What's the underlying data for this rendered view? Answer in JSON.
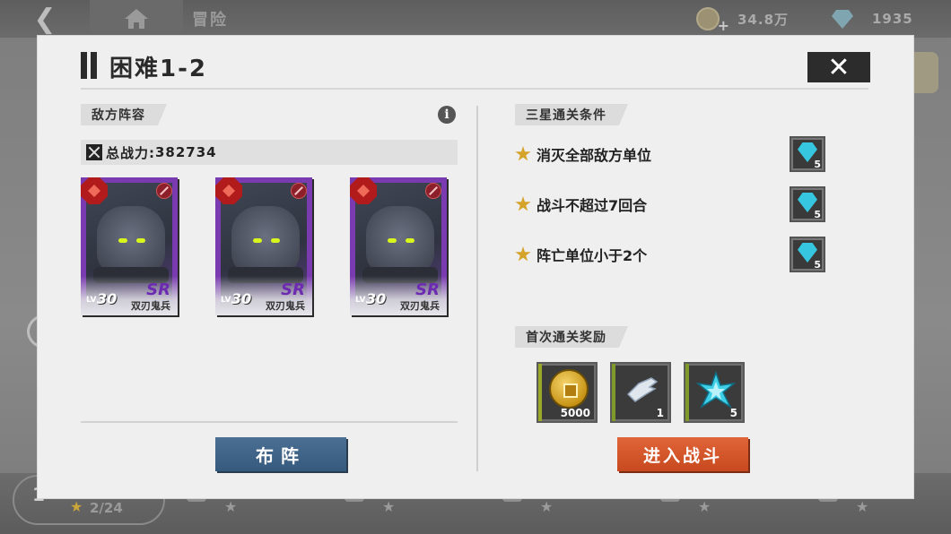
{
  "topbar": {
    "crumb": "冒险",
    "coins": "34.8万",
    "gems": "1935"
  },
  "bottom": {
    "chapter_num": "1",
    "progress": "2/24"
  },
  "dialog": {
    "title": "困难1-2",
    "enemy_section": "敌方阵容",
    "power_label": "总战力:",
    "power_value": "382734",
    "units": [
      {
        "level_label": "LV",
        "level": "30",
        "rarity": "SR",
        "name": "双刃鬼兵"
      },
      {
        "level_label": "LV",
        "level": "30",
        "rarity": "SR",
        "name": "双刃鬼兵"
      },
      {
        "level_label": "LV",
        "level": "30",
        "rarity": "SR",
        "name": "双刃鬼兵"
      }
    ],
    "deploy_label": "布阵",
    "conditions_section": "三星通关条件",
    "conditions": [
      {
        "text": "消灭全部敌方单位",
        "reward_qty": "5"
      },
      {
        "text": "战斗不超过7回合",
        "reward_qty": "5"
      },
      {
        "text": "阵亡单位小于2个",
        "reward_qty": "5"
      }
    ],
    "first_clear_section": "首次通关奖励",
    "rewards": [
      {
        "icon": "gold-coin-icon",
        "qty": "5000"
      },
      {
        "icon": "glove-icon",
        "qty": "1"
      },
      {
        "icon": "crystal-star-icon",
        "qty": "5"
      }
    ],
    "battle_label": "进入战斗"
  },
  "colors": {
    "deploy_button": "#3f6589",
    "battle_button": "#d4552a",
    "card_frame": "#7a3bb0",
    "gem": "#36c6e0"
  }
}
